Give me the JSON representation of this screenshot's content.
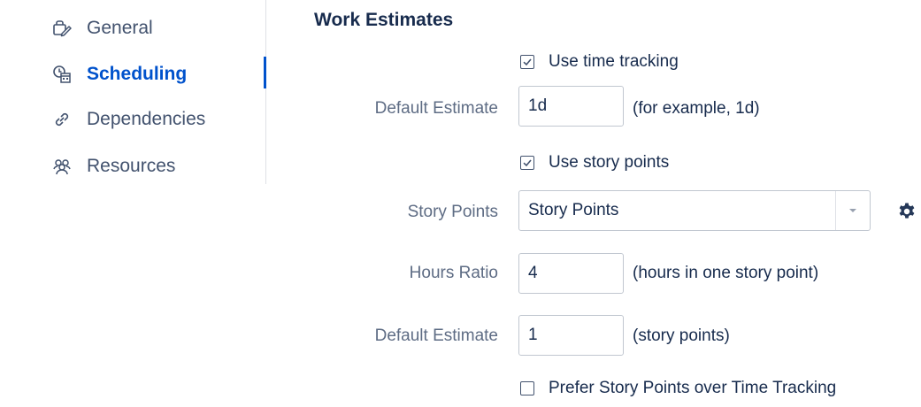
{
  "sidebar": {
    "items": [
      {
        "label": "General",
        "icon": "general-settings-icon",
        "active": false
      },
      {
        "label": "Scheduling",
        "icon": "scheduling-calendar-icon",
        "active": true
      },
      {
        "label": "Dependencies",
        "icon": "link-icon",
        "active": false
      },
      {
        "label": "Resources",
        "icon": "people-icon",
        "active": false
      }
    ]
  },
  "main": {
    "section_title": "Work Estimates",
    "use_time_tracking": {
      "label": "Use time tracking",
      "checked": true
    },
    "default_estimate_time": {
      "label": "Default Estimate",
      "value": "1d",
      "hint": "(for example, 1d)"
    },
    "use_story_points": {
      "label": "Use story points",
      "checked": true
    },
    "story_points": {
      "label": "Story Points",
      "selected": "Story Points",
      "icon": "gear-icon"
    },
    "hours_ratio": {
      "label": "Hours Ratio",
      "value": "4",
      "hint": "(hours in one story point)"
    },
    "default_estimate_points": {
      "label": "Default Estimate",
      "value": "1",
      "hint": "(story points)"
    },
    "prefer_story_points": {
      "label": "Prefer Story Points over Time Tracking",
      "checked": false
    }
  },
  "colors": {
    "accent": "#0052cc",
    "label": "#5e6c84",
    "text": "#172b4d",
    "nav_text": "#42526e",
    "border": "#c1c7d0"
  }
}
